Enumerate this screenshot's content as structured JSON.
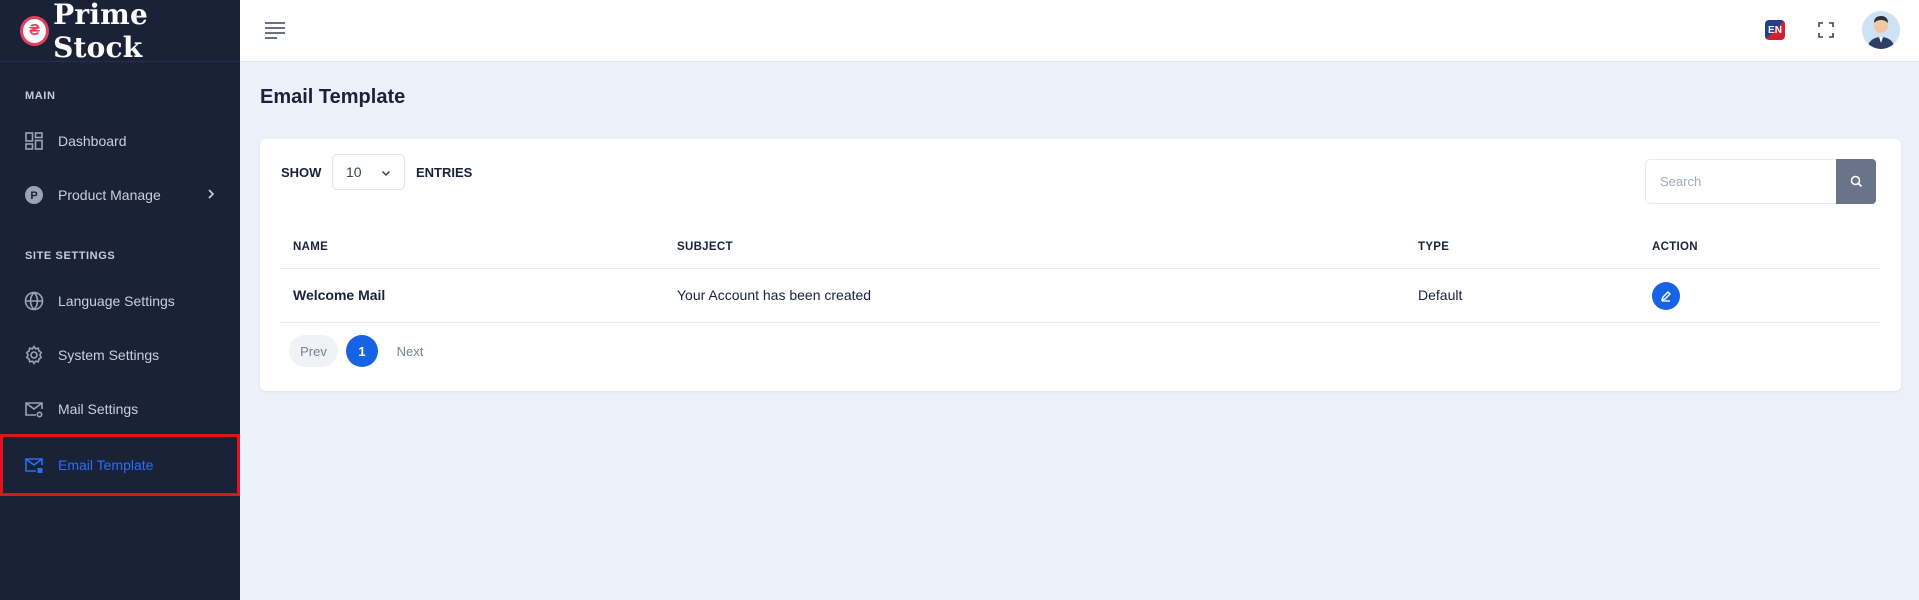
{
  "app": {
    "name": "Prime Stock"
  },
  "sidebar": {
    "sections": [
      {
        "label": "MAIN"
      },
      {
        "label": "SITE SETTINGS"
      }
    ],
    "items": [
      {
        "label": "Dashboard",
        "icon": "dashboard-icon"
      },
      {
        "label": "Product Manage",
        "icon": "product-icon"
      },
      {
        "label": "Language Settings",
        "icon": "globe-icon"
      },
      {
        "label": "System Settings",
        "icon": "gear-icon"
      },
      {
        "label": "Mail Settings",
        "icon": "mail-settings-icon"
      },
      {
        "label": "Email Template",
        "icon": "email-template-icon",
        "active": true
      }
    ]
  },
  "topbar": {
    "language_code": "EN"
  },
  "page": {
    "title": "Email Template"
  },
  "table_controls": {
    "show_label": "SHOW",
    "entries_value": "10",
    "entries_label": "ENTRIES",
    "search_placeholder": "Search"
  },
  "table": {
    "columns": [
      "NAME",
      "SUBJECT",
      "TYPE",
      "ACTION"
    ],
    "rows": [
      {
        "name": "Welcome Mail",
        "subject": "Your Account has been created",
        "type": "Default"
      }
    ]
  },
  "pagination": {
    "prev": "Prev",
    "current": "1",
    "next": "Next"
  },
  "colors": {
    "sidebar_bg": "#1a2238",
    "accent": "#1663e4",
    "active_text": "#2b6ef5",
    "highlight_border": "#e0141e",
    "page_bg": "#ecf0f9"
  }
}
